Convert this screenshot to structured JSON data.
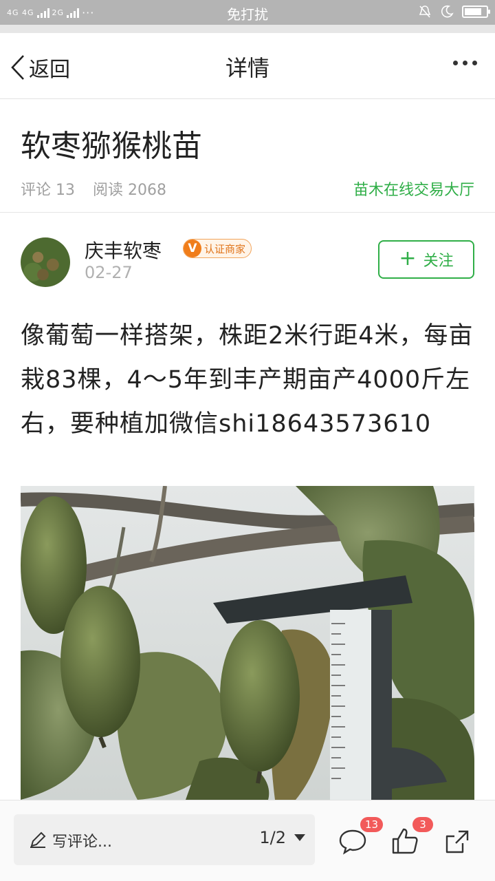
{
  "status_bar": {
    "network_left": "4G 4G",
    "network_right": "2G",
    "dots": "···",
    "mode": "免打扰"
  },
  "nav": {
    "back_label": "返回",
    "title": "详情"
  },
  "article": {
    "title": "软枣猕猴桃苗",
    "comments_label": "评论 13",
    "reads_label": "阅读 2068",
    "source_link": "苗木在线交易大厅"
  },
  "author": {
    "name": "庆丰软枣",
    "badge_icon": "V",
    "badge_text": "认证商家",
    "date": "02-27",
    "follow_label": "关注"
  },
  "post": {
    "text": "像葡萄一样搭架，株距2米行距4米，每亩栽83棵，4～5年到丰产期亩产4000斤左右，要种植加微信shi18643573610"
  },
  "bottom_bar": {
    "comment_placeholder": "写评论...",
    "page_indicator": "1/2",
    "comment_count": "13",
    "like_count": "3"
  },
  "colors": {
    "accent_green": "#2fae47",
    "badge_orange": "#f07d1a",
    "count_red": "#f25a5a"
  }
}
